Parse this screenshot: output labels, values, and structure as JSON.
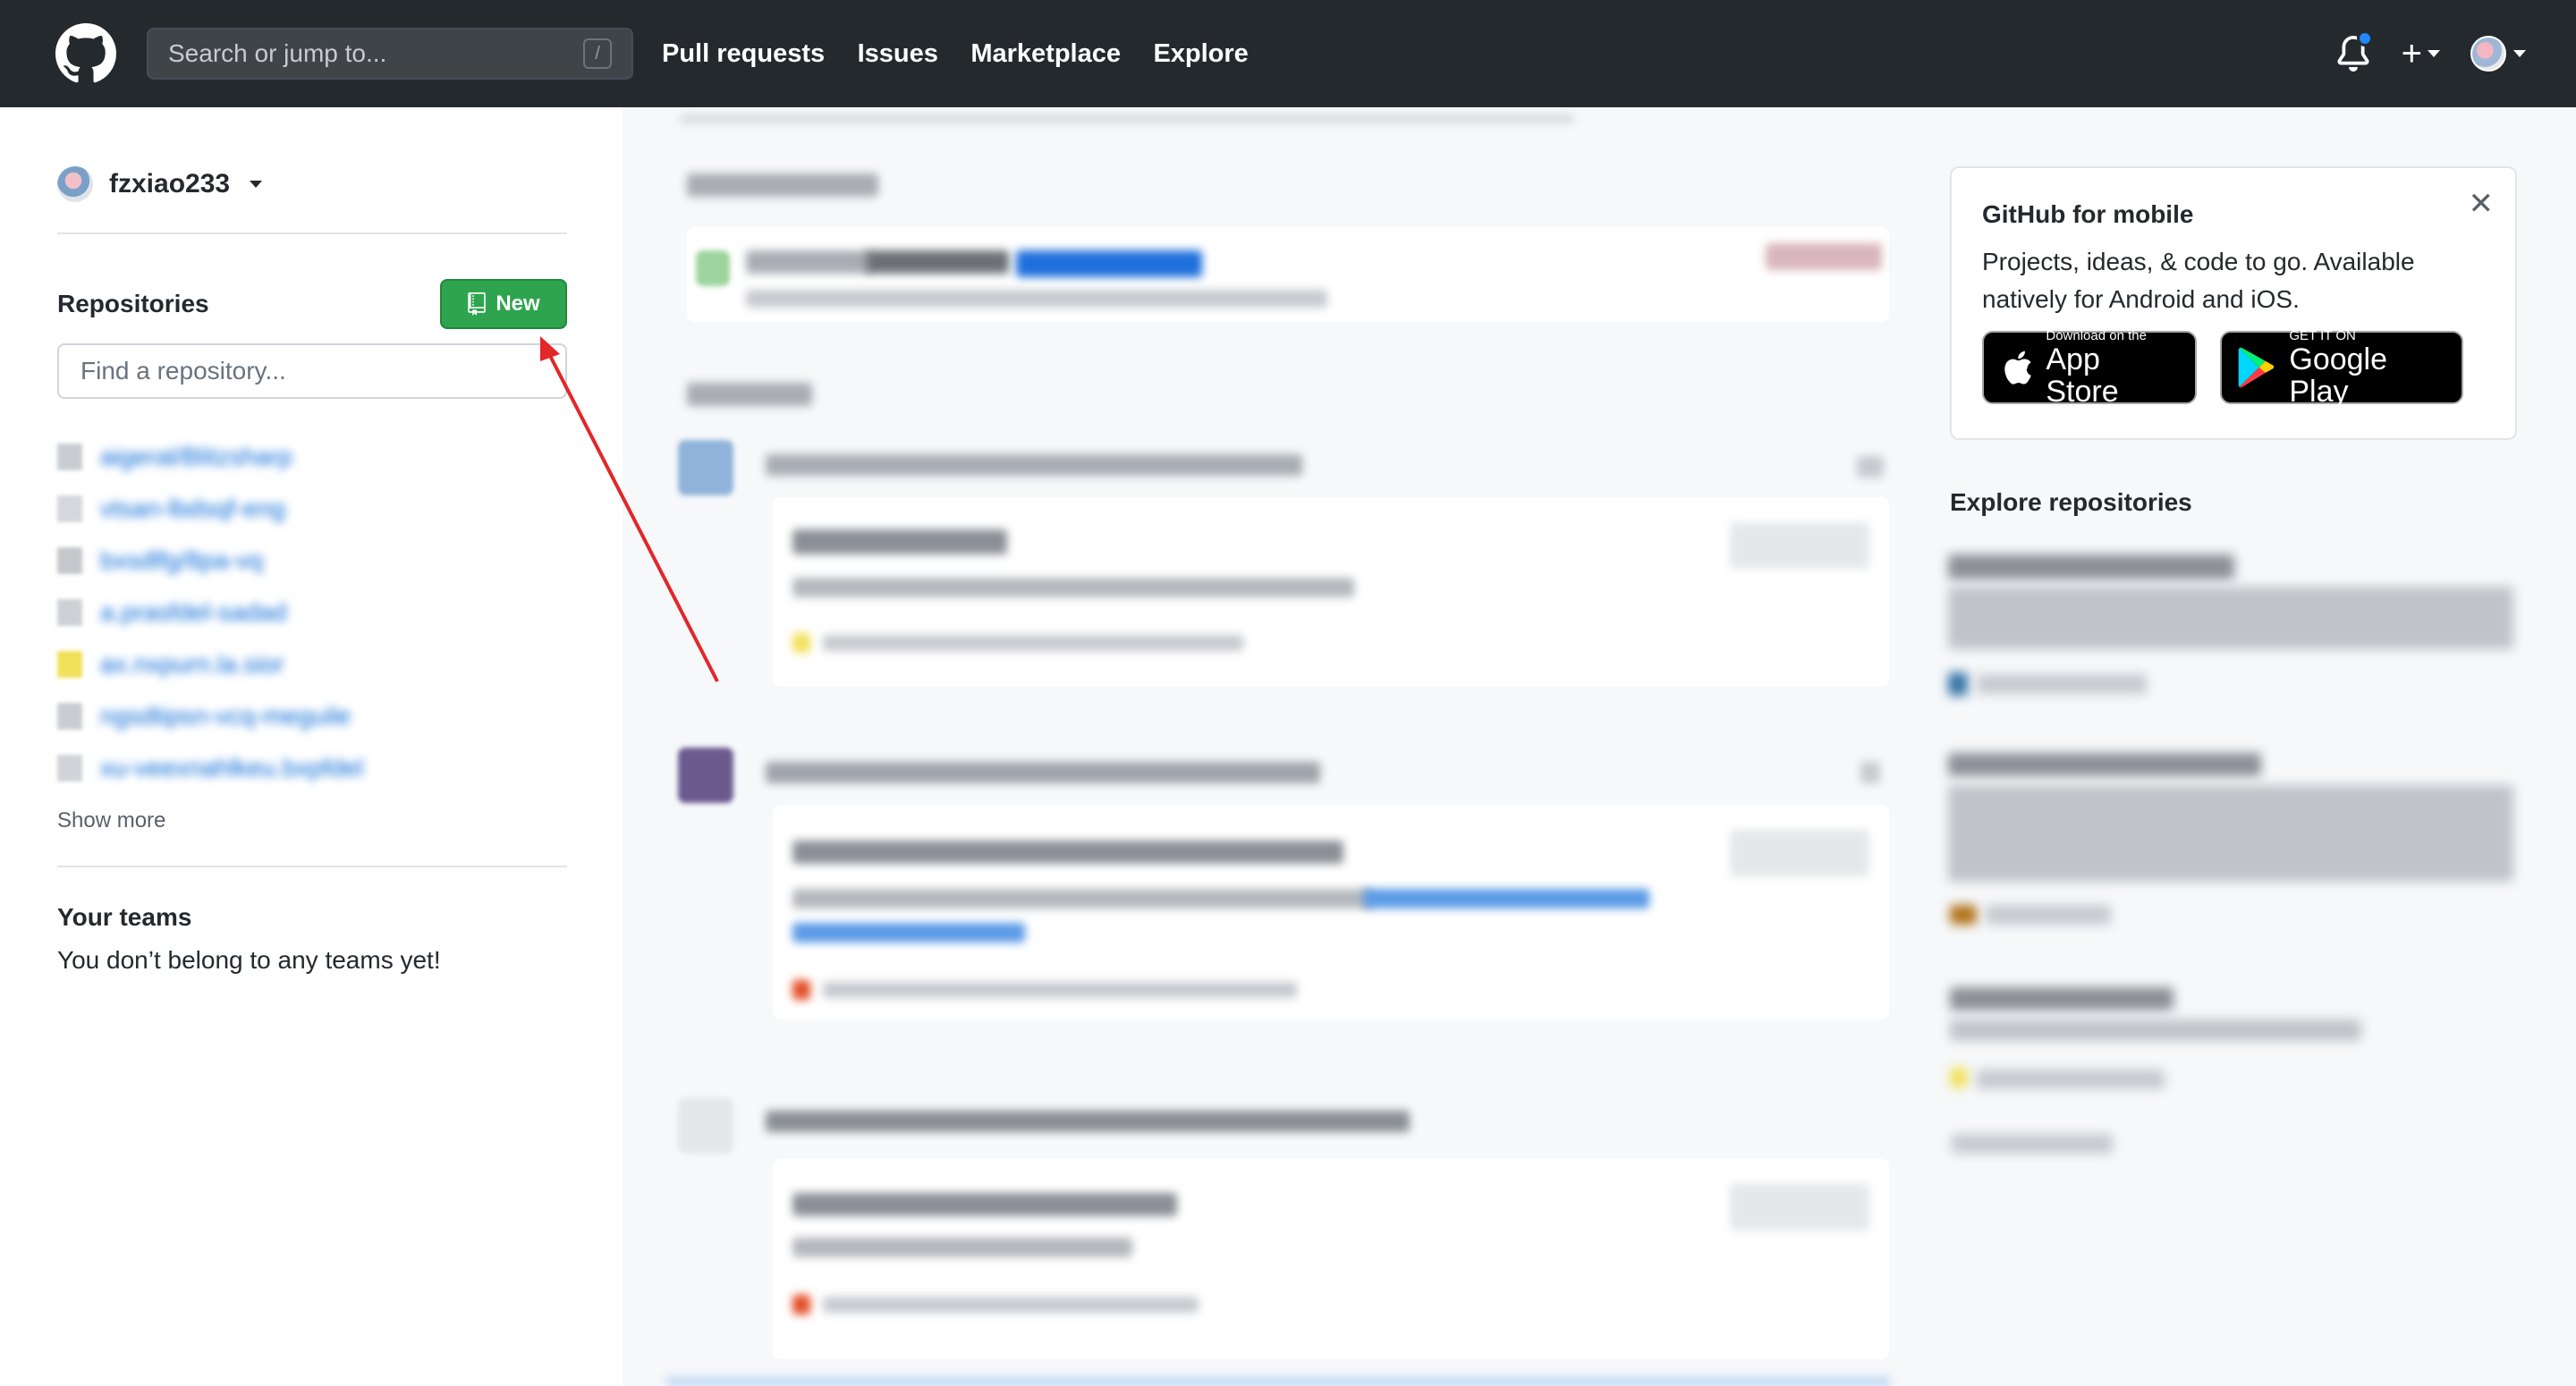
{
  "header": {
    "search_placeholder": "Search or jump to...",
    "search_shortcut": "/",
    "nav": [
      "Pull requests",
      "Issues",
      "Marketplace",
      "Explore"
    ],
    "plus_symbol": "+"
  },
  "sidebar": {
    "username": "fzxiao233",
    "repositories_heading": "Repositories",
    "new_button_label": "New",
    "find_placeholder": "Find a repository...",
    "repos_blurred": [
      "aigeral/Blitzsharp",
      "vtsan-lbdsqf-eng",
      "bxsdlfg/8pa-vq",
      "a.prasfdel-sadad",
      "ax.nxpurn.la.sior",
      "ngsdtipsn-vcq-meguile",
      "xu-veexnahlkeu.bxpfdel"
    ],
    "show_more": "Show more",
    "teams_heading": "Your teams",
    "teams_text": "You don’t belong to any teams yet!"
  },
  "right": {
    "mobile_title": "GitHub for mobile",
    "mobile_desc": "Projects, ideas, & code to go. Available natively for Android and iOS.",
    "close_symbol": "✕",
    "appstore_small": "Download on the",
    "appstore_big": "App Store",
    "googleplay_small": "GET IT ON",
    "googleplay_big": "Google Play",
    "explore_heading": "Explore repositories"
  },
  "colors": {
    "header_bg": "#24292e",
    "new_button": "#2ea44f",
    "link_blue": "#0366d6",
    "annotation_arrow": "#e3262a"
  }
}
